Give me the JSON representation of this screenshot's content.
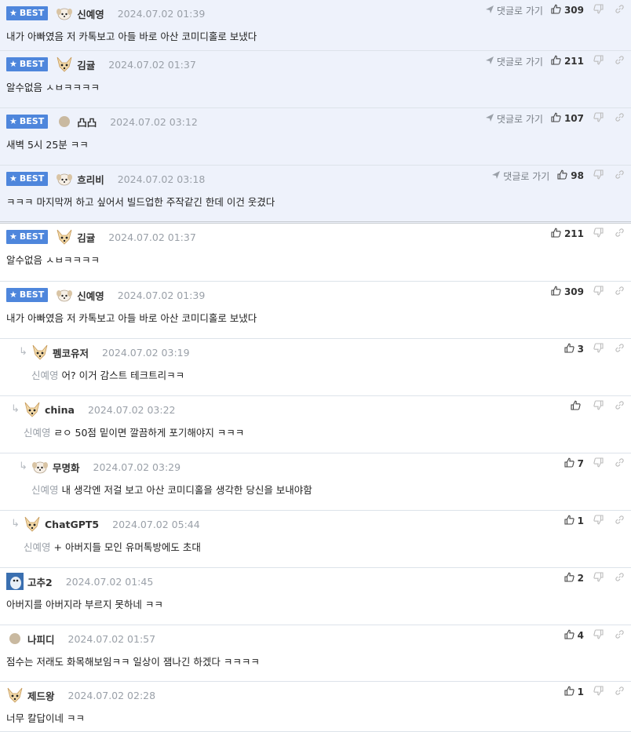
{
  "colors": {
    "best_bg": "#eef2fb",
    "badge": "#4e86dc",
    "date": "#9aa0a8",
    "reply_to": "#9aa0a8"
  },
  "labels": {
    "best": "BEST",
    "goto": "댓글로 가기"
  },
  "comments": [
    {
      "best": true,
      "goto": true,
      "avatar": "dog-white-icon",
      "nick": "신예영",
      "date": "2024.07.02 01:39",
      "likes": "309",
      "text": "내가 아빠였음 저 카톡보고 아들 바로 아산 코미디홀로 보냈다"
    },
    {
      "best": true,
      "goto": true,
      "avatar": "fox-icon",
      "nick": "김귤",
      "date": "2024.07.02 01:37",
      "likes": "211",
      "text": "알수없음 ㅅㅂㅋㅋㅋㅋ"
    },
    {
      "best": true,
      "goto": true,
      "avatar": "circle-icon",
      "nick": "凸凸",
      "date": "2024.07.02 03:12",
      "likes": "107",
      "text": "새벽 5시 25분 ㅋㅋ"
    },
    {
      "best": true,
      "goto": true,
      "avatar": "dog-white-icon",
      "nick": "흐리비",
      "date": "2024.07.02 03:18",
      "likes": "98",
      "text": "ㅋㅋㅋ 마지막꺼 하고 싶어서 빌드업한 주작같긴 한데 이건 웃겼다"
    },
    {
      "best": true,
      "goto": false,
      "avatar": "fox-icon",
      "nick": "김귤",
      "date": "2024.07.02 01:37",
      "likes": "211",
      "text": "알수없음 ㅅㅂㅋㅋㅋㅋ"
    },
    {
      "best": true,
      "goto": false,
      "avatar": "dog-white-icon",
      "nick": "신예영",
      "date": "2024.07.02 01:39",
      "likes": "309",
      "text": "내가 아빠였음 저 카톡보고 아들 바로 아산 코미디홀로 보냈다"
    },
    {
      "reply": true,
      "avatar": "fox-icon",
      "nick": "펨코유저",
      "date": "2024.07.02 03:19",
      "likes": "3",
      "reply_to": "신예영",
      "text": "어? 이거 감스트 테크트리ㅋㅋ"
    },
    {
      "reply": true,
      "avatar": "fox-icon",
      "nick": "china",
      "date": "2024.07.02 03:22",
      "likes": "",
      "reply_to": "신예영",
      "text": "ㄹㅇ 50점 밑이면 깔끔하게 포기해야지 ㅋㅋㅋ"
    },
    {
      "reply": true,
      "avatar": "dog-white-icon",
      "nick": "무명화",
      "date": "2024.07.02 03:29",
      "likes": "7",
      "reply_to": "신예영",
      "text": "내 생각엔 저걸 보고 아산 코미디홀을 생각한 당신을 보내야함"
    },
    {
      "reply": true,
      "avatar": "fox-icon",
      "nick": "ChatGPT5",
      "date": "2024.07.02 05:44",
      "likes": "1",
      "reply_to": "신예영",
      "text": "+ 아버지들 모인 유머톡방에도 초대"
    },
    {
      "avatar": "penguin-icon",
      "nick": "고추2",
      "date": "2024.07.02 01:45",
      "likes": "2",
      "text": "아버지를 아버지라 부르지 못하네 ㅋㅋ"
    },
    {
      "avatar": "circle-icon",
      "nick": "나피디",
      "date": "2024.07.02 01:57",
      "likes": "4",
      "text": "점수는 저래도 화목해보임ㅋㅋ 일상이 잼나긴 하겠다 ㅋㅋㅋㅋ"
    },
    {
      "avatar": "fox-icon",
      "nick": "제드왕",
      "date": "2024.07.02 02:28",
      "likes": "1",
      "text": "너무 칼답이네 ㅋㅋ"
    }
  ]
}
